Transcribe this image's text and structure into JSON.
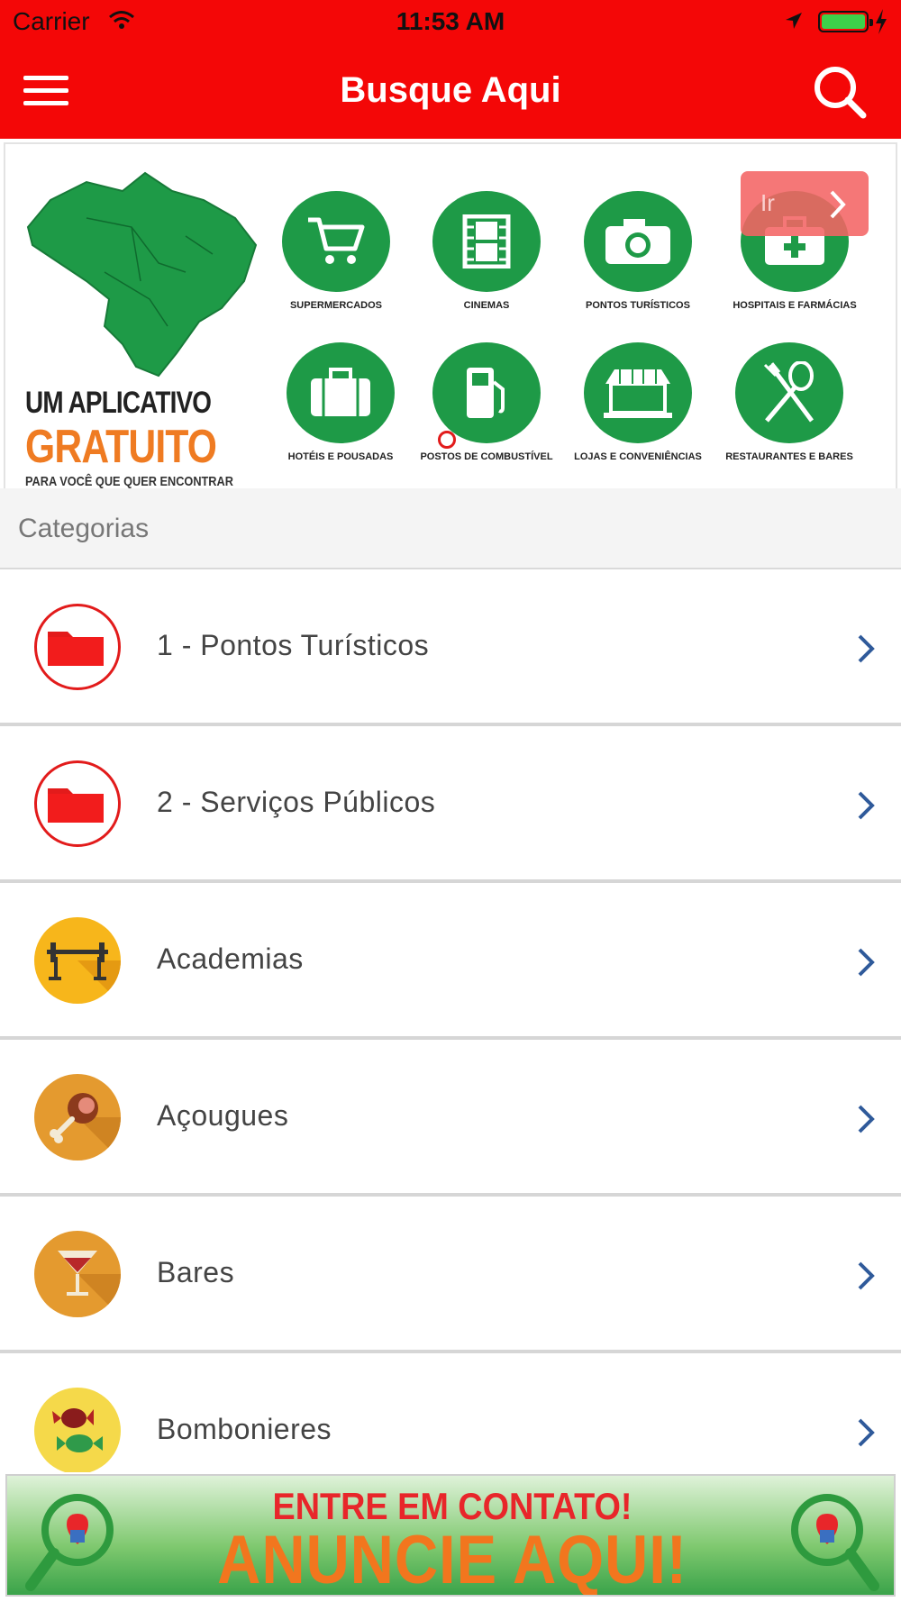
{
  "status_bar": {
    "carrier": "Carrier",
    "time": "11:53 AM"
  },
  "nav": {
    "title": "Busque Aqui",
    "menu_icon": "hamburger-menu-icon",
    "search_icon": "search-icon"
  },
  "banner": {
    "slogan_line1": "UM APLICATIVO",
    "slogan_line2": "GRATUITO",
    "slogan_line3": "PARA VOCÊ QUE QUER ENCONTRAR",
    "go_label": "Ir",
    "icons": [
      {
        "name": "SUPERMERCADOS",
        "icon": "cart-icon"
      },
      {
        "name": "CINEMAS",
        "icon": "film-icon"
      },
      {
        "name": "PONTOS TURÍSTICOS",
        "icon": "camera-icon"
      },
      {
        "name": "HOSPITAIS E FARMÁCIAS",
        "icon": "medkit-icon"
      },
      {
        "name": "HOTÉIS E POUSADAS",
        "icon": "suitcase-icon"
      },
      {
        "name": "POSTOS DE COMBUSTÍVEL",
        "icon": "fuel-icon"
      },
      {
        "name": "LOJAS E CONVENIÊNCIAS",
        "icon": "store-icon"
      },
      {
        "name": "RESTAURANTES E BARES",
        "icon": "cutlery-icon"
      }
    ]
  },
  "section": {
    "header": "Categorias"
  },
  "categories": [
    {
      "label": "1 - Pontos Turísticos",
      "icon": "folder-icon"
    },
    {
      "label": "2 - Serviços Públicos",
      "icon": "folder-icon"
    },
    {
      "label": "Academias",
      "icon": "barbell-icon"
    },
    {
      "label": "Açougues",
      "icon": "meat-icon"
    },
    {
      "label": "Bares",
      "icon": "cocktail-icon"
    },
    {
      "label": "Bombonieres",
      "icon": "candy-icon"
    }
  ],
  "ad": {
    "line1": "ENTRE EM CONTATO!",
    "line2": "ANUNCIE AQUI!"
  },
  "colors": {
    "primary_red": "#f40707",
    "banner_green": "#1e9a47",
    "chevron_blue": "#2f5a9a"
  }
}
